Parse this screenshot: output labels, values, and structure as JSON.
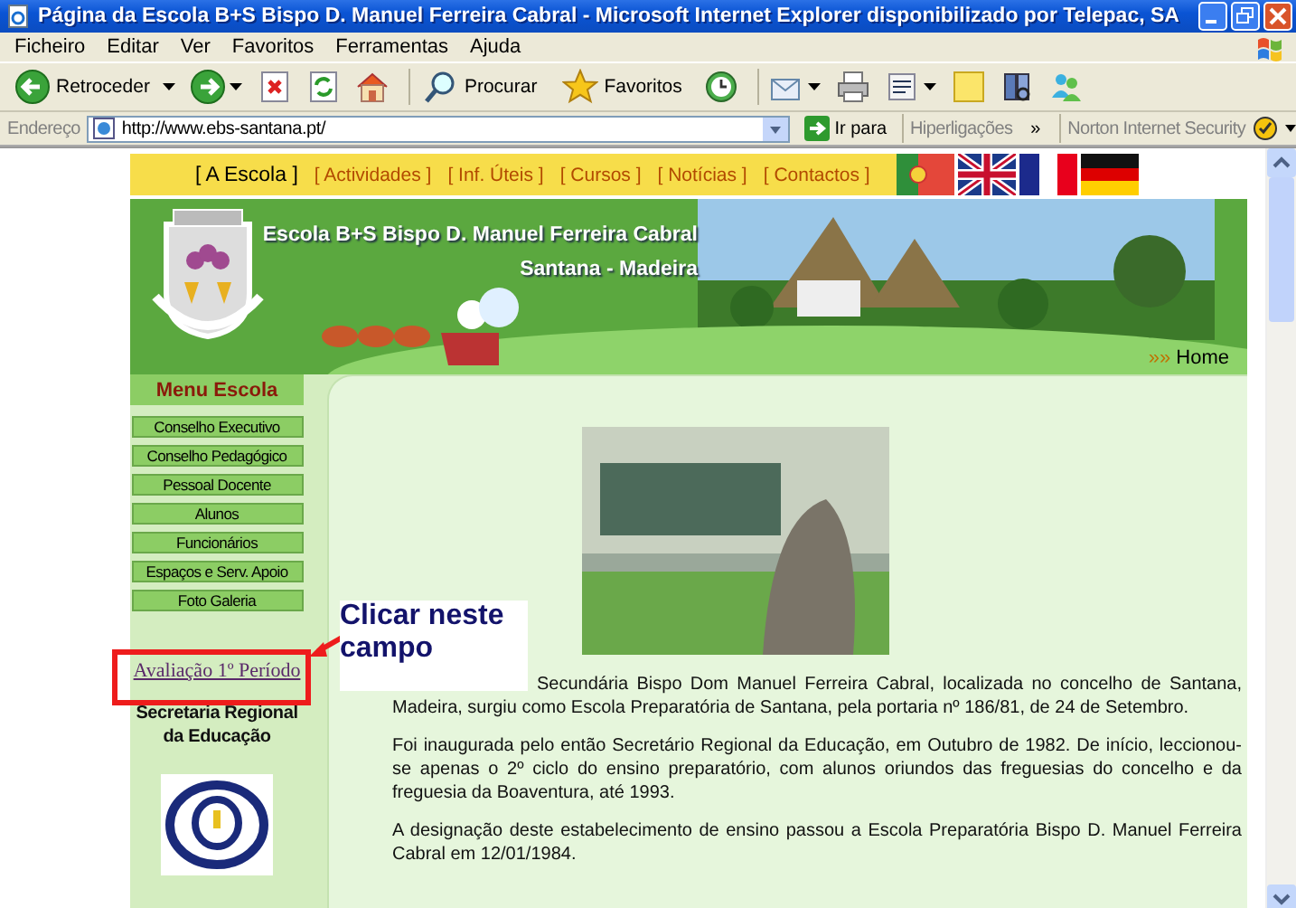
{
  "window": {
    "title": "Página da Escola B+S Bispo D. Manuel Ferreira Cabral - Microsoft Internet Explorer disponibilizado por Telepac, SA"
  },
  "menu_bar": [
    "Ficheiro",
    "Editar",
    "Ver",
    "Favoritos",
    "Ferramentas",
    "Ajuda"
  ],
  "toolbar": [
    {
      "kind": "back",
      "label": "Retroceder",
      "dropdown": true
    },
    {
      "kind": "forward",
      "dropdown": true
    },
    {
      "kind": "stop"
    },
    {
      "kind": "refresh"
    },
    {
      "kind": "home"
    },
    {
      "kind": "search",
      "label": "Procurar"
    },
    {
      "kind": "favorites",
      "label": "Favoritos"
    },
    {
      "kind": "history"
    },
    {
      "kind": "mail",
      "dropdown": true
    },
    {
      "kind": "print"
    },
    {
      "kind": "edit",
      "dropdown": true
    },
    {
      "kind": "note"
    },
    {
      "kind": "research"
    },
    {
      "kind": "messenger"
    }
  ],
  "address_bar": {
    "label": "Endereço",
    "url": "http://www.ebs-santana.pt/",
    "go": "Ir para",
    "links": "Hiperligações",
    "chevron": "»",
    "norton": "Norton Internet Security"
  },
  "site": {
    "nav": [
      {
        "label": "[ A Escola ]",
        "selected": true
      },
      {
        "label": "[ Actividades ]",
        "selected": false
      },
      {
        "label": "[ Inf. Úteis ]",
        "selected": false
      },
      {
        "label": "[ Cursos ]",
        "selected": false
      },
      {
        "label": "[ Notícias ]",
        "selected": false
      },
      {
        "label": "[ Contactos ]",
        "selected": false
      }
    ],
    "flags": [
      {
        "kind": "pt"
      },
      {
        "kind": "uk"
      },
      {
        "kind": "fr"
      },
      {
        "kind": "de"
      }
    ],
    "header": {
      "title": "Escola B+S Bispo D. Manuel Ferreira Cabral",
      "subtitle": "Santana - Madeira",
      "home_marker": "»»",
      "home": "Home"
    },
    "sidebar": {
      "title": "Menu Escola",
      "items": [
        "Conselho Executivo",
        "Conselho Pedagógico",
        "Pessoal Docente",
        "Alunos",
        "Funcionários",
        "Espaços e Serv. Apoio",
        "Foto Galeria"
      ],
      "link": "Avaliação 1º Período",
      "secretaria": "Secretaria Regional da Educação"
    },
    "paragraphs": [
      "Secundária Bispo Dom Manuel Ferreira Cabral, localizada no concelho de Santana, Madeira, surgiu como Escola Preparatória de Santana, pela portaria nº 186/81, de 24 de Setembro.",
      "Foi inaugurada pelo então Secretário Regional da Educação, em Outubro de 1982. De início, leccionou-se apenas o 2º ciclo do ensino preparatório, com alunos oriundos das freguesias do concelho e da freguesia da Boaventura, até 1993.",
      "A designação deste estabelecimento de ensino passou a Escola Preparatória Bispo D. Manuel Ferreira Cabral em 12/01/1984."
    ]
  },
  "annotation": {
    "text": "Clicar neste campo"
  }
}
